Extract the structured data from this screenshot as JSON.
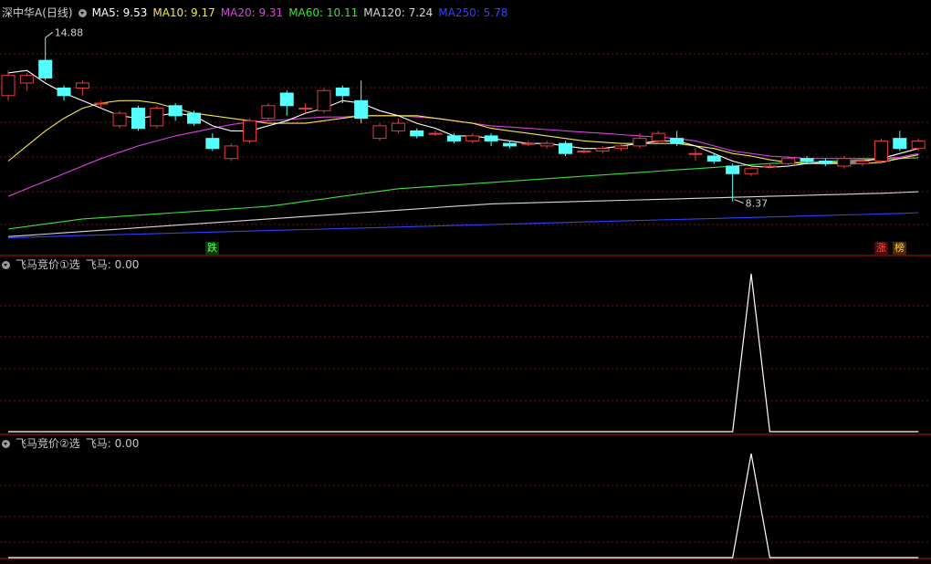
{
  "header": {
    "stock_title": "深中华A(日线)",
    "ma_labels": [
      {
        "text": "MA5: 9.53",
        "color": "#ffffff"
      },
      {
        "text": "MA10: 9.17",
        "color": "#f5e84a"
      },
      {
        "text": "MA20: 9.31",
        "color": "#e040e0"
      },
      {
        "text": "MA60: 10.11",
        "color": "#3ce03c"
      },
      {
        "text": "MA120: 7.24",
        "color": "#d8d8d8"
      },
      {
        "text": "MA250: 5.78",
        "color": "#3040ff"
      }
    ]
  },
  "panels": [
    {
      "title": "飞马竞价①选",
      "value_label": "飞马: 0.00"
    },
    {
      "title": "飞马竞价②选",
      "value_label": "飞马: 0.00"
    }
  ],
  "badges": {
    "fall": "跌",
    "rise": "涨",
    "list": "榜"
  },
  "colors": {
    "up": "#e83c3c",
    "down": "#54ffff",
    "grid": "#7a1010",
    "ma5": "#ffffff",
    "ma10": "#f5e84a",
    "ma20": "#e040e0",
    "ma60": "#3ce03c",
    "ma120": "#d8d8d8",
    "ma250": "#3040ff"
  },
  "chart_data": {
    "type": "candlestick",
    "price_range": [
      6.9,
      15.6
    ],
    "high_annotation": "14.88",
    "low_annotation": "8.37",
    "candles": [
      [
        12.6,
        13.4,
        12.4,
        13.6
      ],
      [
        13.1,
        13.4,
        12.8,
        13.5
      ],
      [
        14.0,
        13.3,
        13.2,
        14.9
      ],
      [
        12.9,
        12.6,
        12.4,
        13.0
      ],
      [
        12.9,
        13.1,
        12.6,
        13.2
      ],
      [
        12.3,
        12.3,
        12.1,
        12.4
      ],
      [
        11.4,
        11.9,
        11.3,
        12.0
      ],
      [
        12.1,
        11.3,
        11.2,
        12.2
      ],
      [
        11.4,
        12.1,
        11.3,
        12.2
      ],
      [
        12.2,
        11.8,
        11.6,
        12.3
      ],
      [
        11.9,
        11.5,
        11.4,
        12.0
      ],
      [
        10.9,
        10.5,
        10.4,
        11.1
      ],
      [
        10.1,
        10.6,
        10.0,
        10.7
      ],
      [
        10.8,
        11.6,
        10.7,
        11.7
      ],
      [
        11.7,
        12.2,
        11.6,
        12.3
      ],
      [
        12.7,
        12.2,
        11.8,
        12.8
      ],
      [
        12.1,
        12.1,
        11.9,
        12.3
      ],
      [
        12.0,
        12.8,
        11.9,
        12.9
      ],
      [
        12.9,
        12.6,
        12.3,
        13.0
      ],
      [
        12.4,
        11.7,
        11.5,
        13.2
      ],
      [
        10.9,
        11.4,
        10.8,
        11.5
      ],
      [
        11.2,
        11.5,
        11.1,
        11.7
      ],
      [
        11.2,
        11.0,
        10.9,
        11.3
      ],
      [
        11.1,
        11.1,
        11.0,
        11.2
      ],
      [
        11.0,
        10.8,
        10.7,
        11.1
      ],
      [
        10.8,
        11.0,
        10.7,
        11.1
      ],
      [
        11.0,
        10.8,
        10.6,
        11.1
      ],
      [
        10.7,
        10.6,
        10.5,
        10.8
      ],
      [
        10.7,
        10.7,
        10.6,
        10.8
      ],
      [
        10.6,
        10.7,
        10.5,
        10.8
      ],
      [
        10.7,
        10.3,
        10.2,
        10.8
      ],
      [
        10.4,
        10.4,
        10.3,
        10.5
      ],
      [
        10.4,
        10.5,
        10.3,
        10.6
      ],
      [
        10.5,
        10.6,
        10.4,
        10.7
      ],
      [
        10.6,
        10.9,
        10.5,
        11.1
      ],
      [
        10.8,
        11.1,
        10.7,
        11.2
      ],
      [
        10.9,
        10.7,
        10.6,
        11.2
      ],
      [
        10.3,
        10.3,
        10.0,
        10.5
      ],
      [
        10.2,
        10.0,
        9.9,
        10.3
      ],
      [
        9.8,
        9.5,
        8.4,
        9.9
      ],
      [
        9.5,
        9.7,
        9.4,
        9.8
      ],
      [
        9.8,
        9.8,
        9.7,
        9.9
      ],
      [
        9.9,
        10.1,
        9.8,
        10.2
      ],
      [
        10.1,
        10.0,
        9.9,
        10.2
      ],
      [
        10.0,
        9.9,
        9.8,
        10.1
      ],
      [
        9.8,
        10.1,
        9.7,
        10.2
      ],
      [
        9.9,
        10.0,
        9.8,
        10.1
      ],
      [
        10.0,
        10.8,
        9.9,
        10.9
      ],
      [
        10.9,
        10.5,
        10.4,
        11.2
      ],
      [
        10.5,
        10.8,
        10.4,
        10.9
      ]
    ],
    "ma5": [
      13.5,
      13.6,
      13.1,
      12.7,
      12.4,
      12.1,
      11.8,
      11.7,
      11.8,
      11.9,
      11.8,
      11.4,
      11.2,
      11.2,
      11.4,
      11.6,
      11.9,
      12.1,
      12.4,
      12.3,
      12.0,
      11.8,
      11.5,
      11.3,
      11.0,
      11.0,
      10.9,
      10.8,
      10.7,
      10.7,
      10.6,
      10.5,
      10.5,
      10.6,
      10.7,
      10.8,
      10.8,
      10.6,
      10.3,
      10.0,
      9.8,
      9.75,
      9.8,
      9.9,
      9.95,
      9.95,
      10.0,
      10.1,
      10.3,
      10.5
    ],
    "ma10": [
      10.0,
      10.6,
      11.2,
      11.7,
      12.1,
      12.3,
      12.4,
      12.4,
      12.3,
      12.1,
      11.9,
      11.8,
      11.7,
      11.6,
      11.5,
      11.5,
      11.5,
      11.6,
      11.7,
      11.8,
      11.8,
      11.8,
      11.8,
      11.7,
      11.6,
      11.5,
      11.3,
      11.2,
      11.1,
      11.0,
      10.9,
      10.8,
      10.75,
      10.7,
      10.7,
      10.7,
      10.7,
      10.6,
      10.5,
      10.3,
      10.2,
      10.05,
      9.95,
      9.9,
      9.9,
      9.9,
      9.9,
      9.95,
      10.1,
      10.25
    ],
    "ma20": [
      8.6,
      8.9,
      9.2,
      9.5,
      9.8,
      10.1,
      10.35,
      10.6,
      10.8,
      11.0,
      11.15,
      11.3,
      11.45,
      11.55,
      11.6,
      11.65,
      11.7,
      11.75,
      11.75,
      11.8,
      11.8,
      11.8,
      11.75,
      11.7,
      11.6,
      11.5,
      11.4,
      11.35,
      11.3,
      11.25,
      11.2,
      11.15,
      11.1,
      11.05,
      11.0,
      10.95,
      10.9,
      10.8,
      10.6,
      10.4,
      10.3,
      10.2,
      10.15,
      10.1,
      10.1,
      10.1,
      10.1,
      10.1,
      10.15,
      10.3
    ],
    "ma60": [
      7.3,
      7.4,
      7.5,
      7.6,
      7.7,
      7.75,
      7.8,
      7.85,
      7.9,
      7.95,
      8.0,
      8.05,
      8.1,
      8.15,
      8.2,
      8.3,
      8.4,
      8.5,
      8.6,
      8.7,
      8.8,
      8.9,
      8.95,
      9.0,
      9.05,
      9.1,
      9.15,
      9.2,
      9.25,
      9.3,
      9.35,
      9.4,
      9.45,
      9.5,
      9.55,
      9.6,
      9.65,
      9.7,
      9.75,
      9.8,
      9.85,
      9.9,
      9.93,
      9.96,
      9.99,
      10.02,
      10.05,
      10.08,
      10.1,
      10.13
    ],
    "ma120": [
      7.0,
      7.05,
      7.1,
      7.15,
      7.2,
      7.25,
      7.3,
      7.35,
      7.4,
      7.45,
      7.5,
      7.55,
      7.6,
      7.65,
      7.7,
      7.75,
      7.8,
      7.85,
      7.9,
      7.95,
      8.0,
      8.05,
      8.1,
      8.15,
      8.2,
      8.25,
      8.3,
      8.32,
      8.34,
      8.36,
      8.38,
      8.4,
      8.42,
      8.44,
      8.46,
      8.48,
      8.5,
      8.52,
      8.54,
      8.56,
      8.58,
      8.6,
      8.62,
      8.64,
      8.66,
      8.68,
      8.7,
      8.72,
      8.75,
      8.78
    ],
    "ma250": [
      6.95,
      6.97,
      7.0,
      7.02,
      7.04,
      7.06,
      7.08,
      7.1,
      7.12,
      7.14,
      7.16,
      7.18,
      7.2,
      7.22,
      7.24,
      7.26,
      7.28,
      7.3,
      7.32,
      7.34,
      7.36,
      7.38,
      7.4,
      7.42,
      7.44,
      7.46,
      7.48,
      7.5,
      7.52,
      7.54,
      7.56,
      7.58,
      7.6,
      7.62,
      7.64,
      7.66,
      7.68,
      7.7,
      7.72,
      7.74,
      7.76,
      7.78,
      7.8,
      7.82,
      7.84,
      7.86,
      7.88,
      7.9,
      7.92,
      7.95
    ],
    "indicator_range": [
      0,
      1
    ],
    "indicator_series": [
      {
        "values": [
          0,
          0,
          0,
          0,
          0,
          0,
          0,
          0,
          0,
          0,
          0,
          0,
          0,
          0,
          0,
          0,
          0,
          0,
          0,
          0,
          0,
          0,
          0,
          0,
          0,
          0,
          0,
          0,
          0,
          0,
          0,
          0,
          0,
          0,
          0,
          0,
          0,
          0,
          0,
          0,
          1,
          0,
          0,
          0,
          0,
          0,
          0,
          0,
          0,
          0
        ]
      },
      {
        "values": [
          0,
          0,
          0,
          0,
          0,
          0,
          0,
          0,
          0,
          0,
          0,
          0,
          0,
          0,
          0,
          0,
          0,
          0,
          0,
          0,
          0,
          0,
          0,
          0,
          0,
          0,
          0,
          0,
          0,
          0,
          0,
          0,
          0,
          0,
          0,
          0,
          0,
          0,
          0,
          0,
          1,
          0,
          0,
          0,
          0,
          0,
          0,
          0,
          0,
          0
        ]
      }
    ]
  }
}
